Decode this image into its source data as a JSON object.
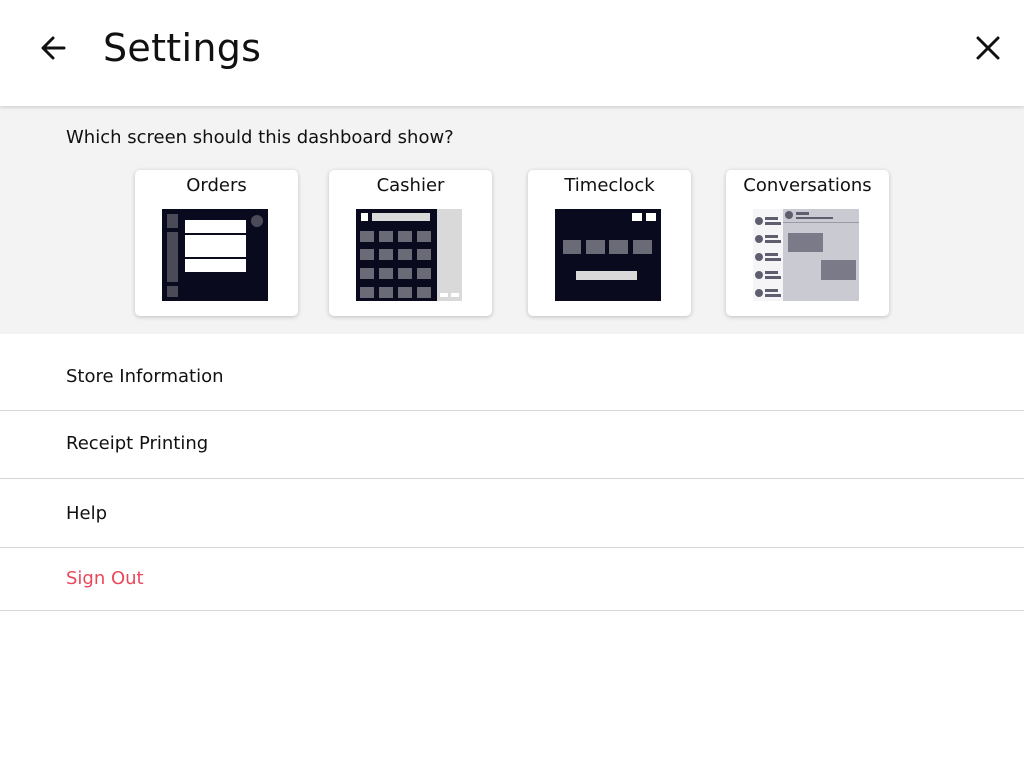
{
  "header": {
    "title": "Settings",
    "back_icon": "arrow-left-icon",
    "close_icon": "close-icon"
  },
  "picker": {
    "question": "Which screen should this dashboard show?",
    "cards": [
      {
        "label": "Orders"
      },
      {
        "label": "Cashier"
      },
      {
        "label": "Timeclock"
      },
      {
        "label": "Conversations"
      }
    ]
  },
  "menu": {
    "items": [
      {
        "label": "Store Information"
      },
      {
        "label": "Receipt Printing"
      },
      {
        "label": "Help"
      },
      {
        "label": "Sign Out"
      }
    ]
  },
  "colors": {
    "accent_danger": "#e8485c",
    "thumb_dark": "#0a0a1e",
    "thumb_tile": "#6b6b78",
    "panel_bg": "#f3f3f3"
  }
}
